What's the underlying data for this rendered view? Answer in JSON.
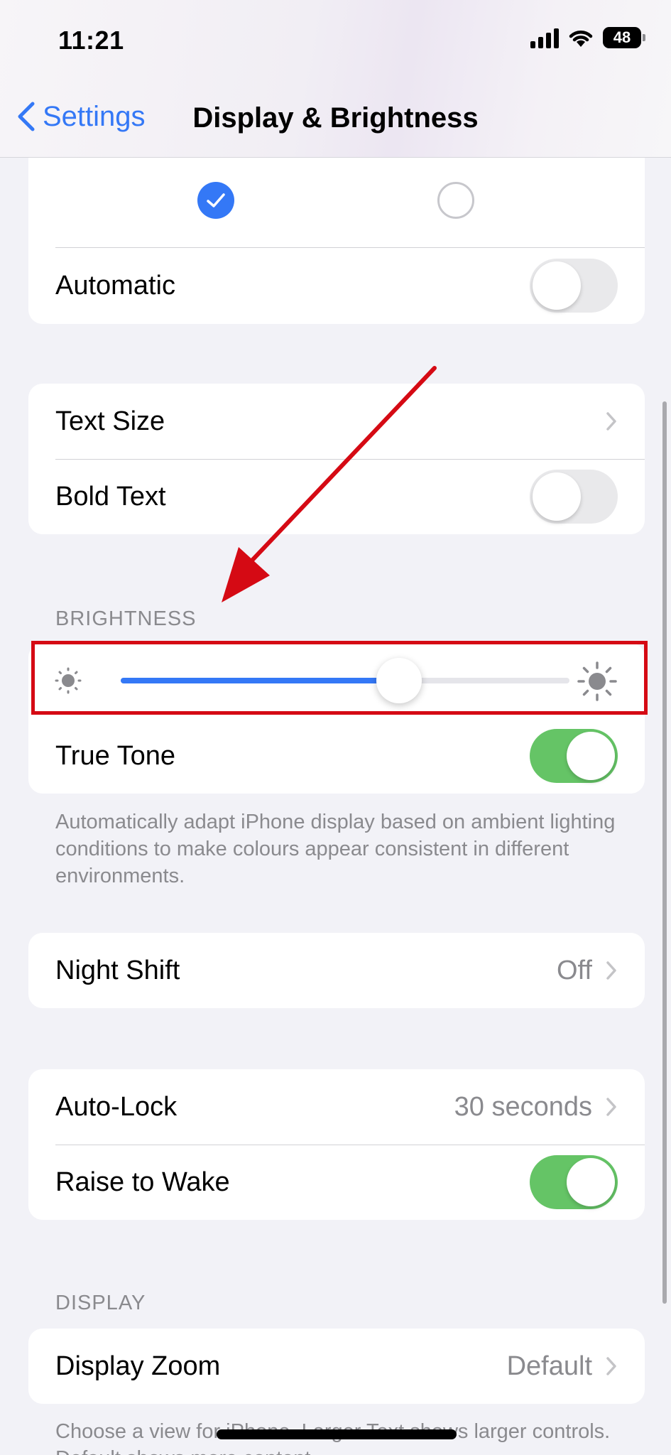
{
  "status_bar": {
    "time": "11:21",
    "battery": "48"
  },
  "nav": {
    "back_label": "Settings",
    "title": "Display & Brightness"
  },
  "appearance": {
    "automatic_label": "Automatic",
    "automatic_on": false
  },
  "text_group": {
    "text_size_label": "Text Size",
    "bold_text_label": "Bold Text",
    "bold_text_on": false
  },
  "brightness": {
    "header": "BRIGHTNESS",
    "level": 0.62,
    "true_tone_label": "True Tone",
    "true_tone_on": true,
    "footer": "Automatically adapt iPhone display based on ambient lighting conditions to make colours appear consistent in different environments."
  },
  "night_shift": {
    "label": "Night Shift",
    "value": "Off"
  },
  "lock_group": {
    "auto_lock_label": "Auto-Lock",
    "auto_lock_value": "30 seconds",
    "raise_to_wake_label": "Raise to Wake",
    "raise_to_wake_on": true
  },
  "display": {
    "header": "DISPLAY",
    "zoom_label": "Display Zoom",
    "zoom_value": "Default",
    "footer": "Choose a view for iPhone. Larger Text shows larger controls. Default shows more content."
  },
  "colors": {
    "accent": "#3478f6",
    "toggle_on": "#65c466",
    "annotation": "#d50a14"
  },
  "annotation_icon": "red-arrow-icon"
}
